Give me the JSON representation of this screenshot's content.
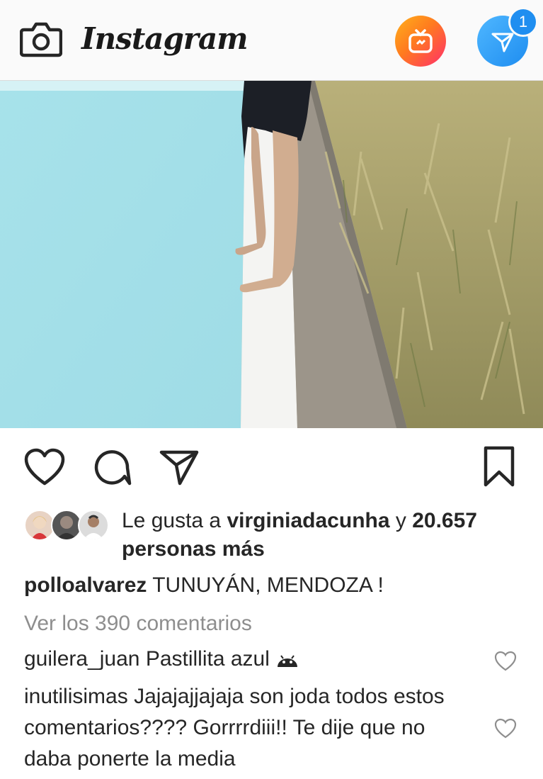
{
  "header": {
    "logo_text": "Instagram",
    "camera_icon": "camera-icon",
    "igtv_icon": "igtv-icon",
    "direct_icon": "paper-plane-icon",
    "direct_badge": "1",
    "colors": {
      "igtv_start": "#ffb11b",
      "igtv_end": "#ff2e6c",
      "direct": "#1e8df0"
    }
  },
  "post": {
    "image_alt": "person standing at pool edge",
    "actions": [
      "heart-icon",
      "comment-icon",
      "share-icon",
      "bookmark-icon"
    ],
    "likes": {
      "prefix": "Le gusta a",
      "user": "virginiadacunha",
      "joiner": "y",
      "count": "20.657",
      "suffix": "personas más"
    },
    "caption": {
      "user": "polloalvarez",
      "text": "TUNUYÁN, MENDOZA !"
    },
    "view_comments": "Ver los 390 comentarios",
    "comments": [
      {
        "user": "guilera_juan",
        "text": "Pastillita azul"
      },
      {
        "user": "inutilisimas",
        "text": "Jajajajjajaja son joda todos estos comentarios???? Gorrrrdiii!! Te dije que no daba ponerte la media"
      }
    ]
  }
}
